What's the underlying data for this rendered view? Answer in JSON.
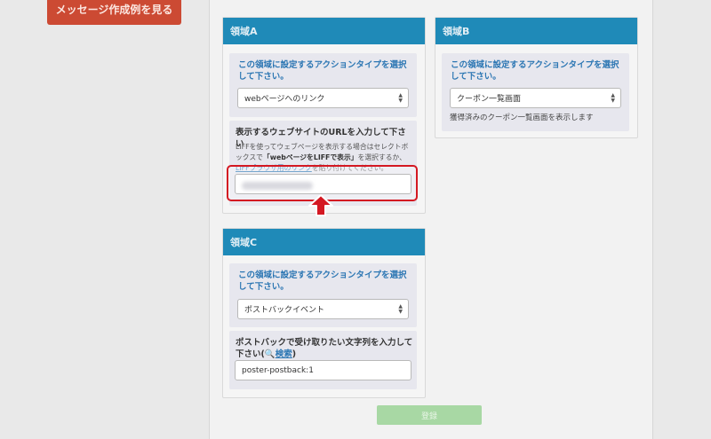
{
  "sidebar": {
    "example_button": "メッセージ作成例を見る"
  },
  "areaA": {
    "title": "領域A",
    "prompt": "この領域に設定するアクションタイプを選択して下さい。",
    "select_value": "webページへのリンク",
    "url_label": "表示するウェブサイトのURLを入力して下さい",
    "desc_1": "LIFFを使ってウェブページを表示する場合はセレクトボックスで",
    "desc_bold": "「webページをLIFFで表示」",
    "desc_2": "を選択するか、",
    "desc_link": "LIFFブラウザ用のリンク",
    "desc_3": "を貼り付けてください。"
  },
  "areaB": {
    "title": "領域B",
    "prompt": "この領域に設定するアクションタイプを選択して下さい。",
    "select_value": "クーポン一覧画面",
    "note": "獲得済みのクーポン一覧画面を表示します"
  },
  "areaC": {
    "title": "領域C",
    "prompt": "この領域に設定するアクションタイプを選択して下さい。",
    "select_value": "ポストバックイベント",
    "postback_label": "ポストバックで受け取りたい文字列を入力して下さい(",
    "search_link": "検索",
    "postback_label_end": ")",
    "postback_value": "poster-postback:1"
  },
  "submit_label": "登録",
  "colors": {
    "header": "#1f8ab8",
    "accent_red": "#d41822",
    "button_red": "#cc4a33",
    "submit_green": "#a8d8a4"
  }
}
